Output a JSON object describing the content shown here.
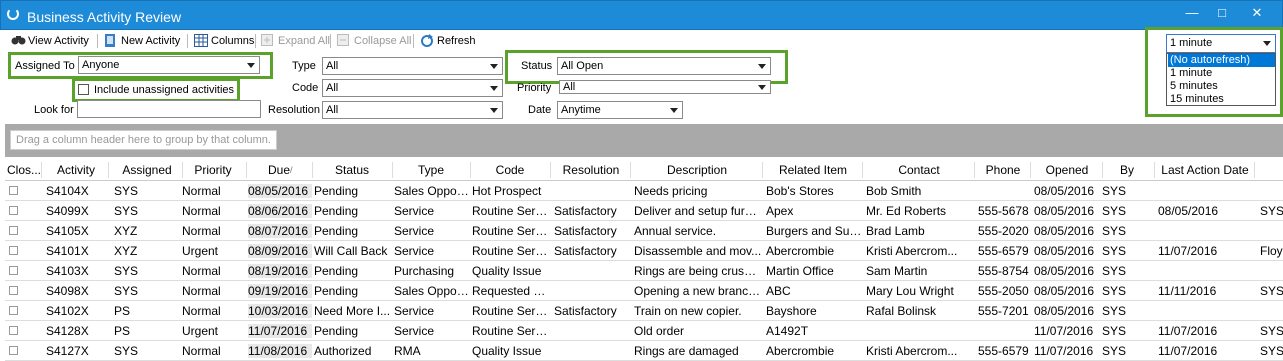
{
  "window": {
    "title": "Business Activity Review"
  },
  "toolbar": {
    "view_activity": "View Activity",
    "new_activity": "New Activity",
    "columns": "Columns",
    "expand_all": "Expand All",
    "collapse_all": "Collapse All",
    "refresh": "Refresh"
  },
  "filters": {
    "assigned_to_label": "Assigned To",
    "assigned_to_value": "Anyone",
    "include_unassigned": "Include unassigned activities",
    "look_for_label": "Look for",
    "look_for_value": "",
    "type_label": "Type",
    "type_value": "All",
    "code_label": "Code",
    "code_value": "All",
    "resolution_label": "Resolution",
    "resolution_value": "All",
    "status_label": "Status",
    "status_value": "All Open",
    "priority_label": "Priority",
    "priority_value": "All",
    "date_label": "Date",
    "date_value": "Anytime"
  },
  "refresh": {
    "selected": "1 minute",
    "options": [
      "(No autorefresh)",
      "1 minute",
      "5 minutes",
      "15 minutes"
    ],
    "highlighted_option": "(No autorefresh)"
  },
  "grid": {
    "group_hint": "Drag a column header here to group by that column.",
    "columns": [
      "Clos...",
      "Activity",
      "Assigned",
      "Priority",
      "Due",
      "Status",
      "Type",
      "Code",
      "Resolution",
      "Description",
      "Related Item",
      "Contact",
      "Phone",
      "Opened",
      "By",
      "Last Action Date"
    ],
    "rows": [
      [
        "",
        "S4104X",
        "SYS",
        "Normal",
        "08/05/2016",
        "Pending",
        "Sales Opport...",
        "Hot Prospect",
        "",
        "Needs pricing",
        "Bob's Stores",
        "Bob Smith",
        "",
        "08/05/2016",
        "SYS",
        "",
        ""
      ],
      [
        "",
        "S4099X",
        "SYS",
        "Normal",
        "08/06/2016",
        "Pending",
        "Service",
        "Routine Serv...",
        "Satisfactory",
        "Deliver and setup furni...",
        "Apex",
        "Mr. Ed Roberts",
        "555-5678",
        "08/05/2016",
        "SYS",
        "08/05/2016",
        "SYS"
      ],
      [
        "",
        "S4105X",
        "XYZ",
        "Normal",
        "08/07/2016",
        "Pending",
        "Service",
        "Routine Serv...",
        "Satisfactory",
        "Annual service.",
        "Burgers and Such",
        "Brad Lamb",
        "555-2020",
        "08/05/2016",
        "SYS",
        "",
        ""
      ],
      [
        "",
        "S4101X",
        "XYZ",
        "Urgent",
        "08/09/2016",
        "Will Call Back",
        "Service",
        "Routine Serv...",
        "Satisfactory",
        "Disassemble and mov...",
        "Abercrombie",
        "Kristi Abercrom...",
        "555-6579",
        "08/05/2016",
        "SYS",
        "11/07/2016",
        "Floy"
      ],
      [
        "",
        "S4103X",
        "SYS",
        "Normal",
        "08/19/2016",
        "Pending",
        "Purchasing",
        "Quality Issue",
        "",
        "Rings are being crushe...",
        "Martin Office",
        "Sam Martin",
        "555-8754",
        "08/05/2016",
        "SYS",
        "",
        ""
      ],
      [
        "",
        "S4098X",
        "SYS",
        "Normal",
        "09/19/2016",
        "Pending",
        "Sales Opport...",
        "Requested Q...",
        "",
        "Opening a new branch...",
        "ABC",
        "Mary Lou Wright",
        "555-2050",
        "08/05/2016",
        "SYS",
        "11/11/2016",
        "SYS"
      ],
      [
        "",
        "S4102X",
        "PS",
        "Normal",
        "10/03/2016",
        "Need More I...",
        "Service",
        "Routine Serv...",
        "Satisfactory",
        "Train on new copier.",
        "Bayshore",
        "Rafal Bolinsk",
        "555-7201",
        "08/05/2016",
        "SYS",
        "",
        ""
      ],
      [
        "",
        "S4128X",
        "PS",
        "Urgent",
        "11/07/2016",
        "Pending",
        "Service",
        "Routine Serv...",
        "",
        "Old order",
        "A1492T",
        "",
        "",
        "11/07/2016",
        "SYS",
        "11/07/2016",
        "SYS"
      ],
      [
        "",
        "S4127X",
        "SYS",
        "Normal",
        "11/08/2016",
        "Authorized",
        "RMA",
        "Quality Issue",
        "",
        "Rings are damaged",
        "Abercrombie",
        "Kristi Abercrom...",
        "555-6579",
        "11/07/2016",
        "SYS",
        "11/07/2016",
        "SYS"
      ]
    ]
  }
}
